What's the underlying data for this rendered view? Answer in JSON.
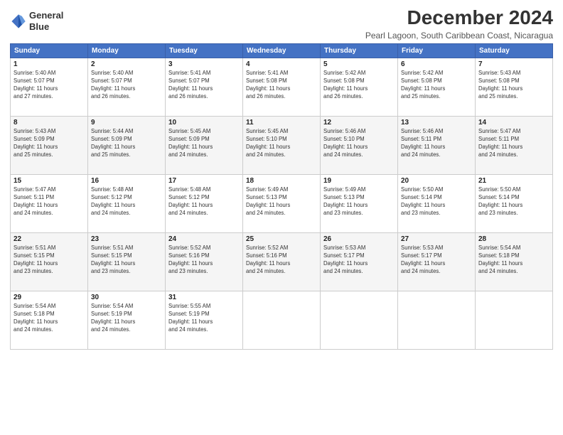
{
  "logo": {
    "line1": "General",
    "line2": "Blue"
  },
  "title": "December 2024",
  "location": "Pearl Lagoon, South Caribbean Coast, Nicaragua",
  "days_header": [
    "Sunday",
    "Monday",
    "Tuesday",
    "Wednesday",
    "Thursday",
    "Friday",
    "Saturday"
  ],
  "weeks": [
    [
      {
        "day": "1",
        "info": "Sunrise: 5:40 AM\nSunset: 5:07 PM\nDaylight: 11 hours\nand 27 minutes."
      },
      {
        "day": "2",
        "info": "Sunrise: 5:40 AM\nSunset: 5:07 PM\nDaylight: 11 hours\nand 26 minutes."
      },
      {
        "day": "3",
        "info": "Sunrise: 5:41 AM\nSunset: 5:07 PM\nDaylight: 11 hours\nand 26 minutes."
      },
      {
        "day": "4",
        "info": "Sunrise: 5:41 AM\nSunset: 5:08 PM\nDaylight: 11 hours\nand 26 minutes."
      },
      {
        "day": "5",
        "info": "Sunrise: 5:42 AM\nSunset: 5:08 PM\nDaylight: 11 hours\nand 26 minutes."
      },
      {
        "day": "6",
        "info": "Sunrise: 5:42 AM\nSunset: 5:08 PM\nDaylight: 11 hours\nand 25 minutes."
      },
      {
        "day": "7",
        "info": "Sunrise: 5:43 AM\nSunset: 5:08 PM\nDaylight: 11 hours\nand 25 minutes."
      }
    ],
    [
      {
        "day": "8",
        "info": "Sunrise: 5:43 AM\nSunset: 5:09 PM\nDaylight: 11 hours\nand 25 minutes."
      },
      {
        "day": "9",
        "info": "Sunrise: 5:44 AM\nSunset: 5:09 PM\nDaylight: 11 hours\nand 25 minutes."
      },
      {
        "day": "10",
        "info": "Sunrise: 5:45 AM\nSunset: 5:09 PM\nDaylight: 11 hours\nand 24 minutes."
      },
      {
        "day": "11",
        "info": "Sunrise: 5:45 AM\nSunset: 5:10 PM\nDaylight: 11 hours\nand 24 minutes."
      },
      {
        "day": "12",
        "info": "Sunrise: 5:46 AM\nSunset: 5:10 PM\nDaylight: 11 hours\nand 24 minutes."
      },
      {
        "day": "13",
        "info": "Sunrise: 5:46 AM\nSunset: 5:11 PM\nDaylight: 11 hours\nand 24 minutes."
      },
      {
        "day": "14",
        "info": "Sunrise: 5:47 AM\nSunset: 5:11 PM\nDaylight: 11 hours\nand 24 minutes."
      }
    ],
    [
      {
        "day": "15",
        "info": "Sunrise: 5:47 AM\nSunset: 5:11 PM\nDaylight: 11 hours\nand 24 minutes."
      },
      {
        "day": "16",
        "info": "Sunrise: 5:48 AM\nSunset: 5:12 PM\nDaylight: 11 hours\nand 24 minutes."
      },
      {
        "day": "17",
        "info": "Sunrise: 5:48 AM\nSunset: 5:12 PM\nDaylight: 11 hours\nand 24 minutes."
      },
      {
        "day": "18",
        "info": "Sunrise: 5:49 AM\nSunset: 5:13 PM\nDaylight: 11 hours\nand 24 minutes."
      },
      {
        "day": "19",
        "info": "Sunrise: 5:49 AM\nSunset: 5:13 PM\nDaylight: 11 hours\nand 23 minutes."
      },
      {
        "day": "20",
        "info": "Sunrise: 5:50 AM\nSunset: 5:14 PM\nDaylight: 11 hours\nand 23 minutes."
      },
      {
        "day": "21",
        "info": "Sunrise: 5:50 AM\nSunset: 5:14 PM\nDaylight: 11 hours\nand 23 minutes."
      }
    ],
    [
      {
        "day": "22",
        "info": "Sunrise: 5:51 AM\nSunset: 5:15 PM\nDaylight: 11 hours\nand 23 minutes."
      },
      {
        "day": "23",
        "info": "Sunrise: 5:51 AM\nSunset: 5:15 PM\nDaylight: 11 hours\nand 23 minutes."
      },
      {
        "day": "24",
        "info": "Sunrise: 5:52 AM\nSunset: 5:16 PM\nDaylight: 11 hours\nand 23 minutes."
      },
      {
        "day": "25",
        "info": "Sunrise: 5:52 AM\nSunset: 5:16 PM\nDaylight: 11 hours\nand 24 minutes."
      },
      {
        "day": "26",
        "info": "Sunrise: 5:53 AM\nSunset: 5:17 PM\nDaylight: 11 hours\nand 24 minutes."
      },
      {
        "day": "27",
        "info": "Sunrise: 5:53 AM\nSunset: 5:17 PM\nDaylight: 11 hours\nand 24 minutes."
      },
      {
        "day": "28",
        "info": "Sunrise: 5:54 AM\nSunset: 5:18 PM\nDaylight: 11 hours\nand 24 minutes."
      }
    ],
    [
      {
        "day": "29",
        "info": "Sunrise: 5:54 AM\nSunset: 5:18 PM\nDaylight: 11 hours\nand 24 minutes."
      },
      {
        "day": "30",
        "info": "Sunrise: 5:54 AM\nSunset: 5:19 PM\nDaylight: 11 hours\nand 24 minutes."
      },
      {
        "day": "31",
        "info": "Sunrise: 5:55 AM\nSunset: 5:19 PM\nDaylight: 11 hours\nand 24 minutes."
      },
      {
        "day": "",
        "info": ""
      },
      {
        "day": "",
        "info": ""
      },
      {
        "day": "",
        "info": ""
      },
      {
        "day": "",
        "info": ""
      }
    ]
  ]
}
